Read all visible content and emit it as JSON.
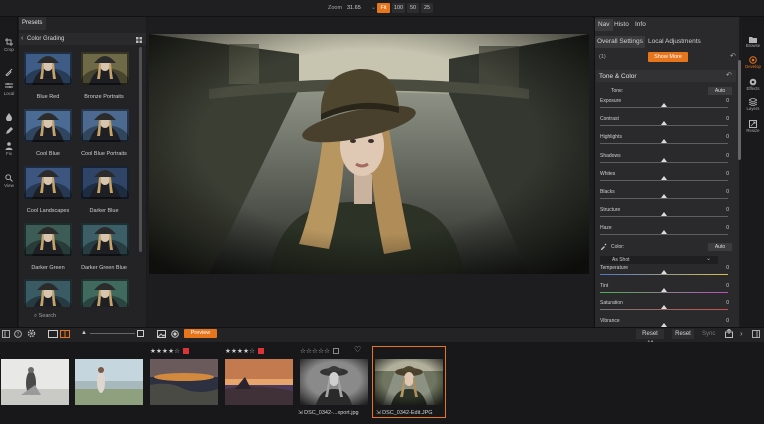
{
  "topbar": {
    "zoom_label": "Zoom",
    "zoom_value": "31.65",
    "zoom_buttons": [
      "Fit",
      "100",
      "50",
      "25"
    ],
    "active_zoom": "Fit"
  },
  "tools": [
    "Crop",
    "",
    "Local",
    "",
    "Fix",
    "View"
  ],
  "presets": {
    "tab": "Presets",
    "category": "Color Grading",
    "items": [
      "Blue Red",
      "Bronze Portraits",
      "Cool Blue",
      "Cool Blue Portraits",
      "Cool Landscapes",
      "Darker Blue",
      "Darker Green",
      "Darker Green Blue"
    ],
    "search": "Search"
  },
  "right_panel": {
    "tabs": [
      "Nav",
      "Histo",
      "Info"
    ],
    "subtabs": [
      "Overall Settings",
      "Local Adjustments"
    ],
    "count": "(1)",
    "show_more": "Show More",
    "section": "Tone & Color",
    "tone_label": "Tone:",
    "auto": "Auto",
    "tone_sliders": [
      {
        "label": "Exposure",
        "value": "0"
      },
      {
        "label": "Contrast",
        "value": "0"
      },
      {
        "label": "Highlights",
        "value": "0"
      },
      {
        "label": "Shadows",
        "value": "0"
      },
      {
        "label": "Whites",
        "value": "0"
      },
      {
        "label": "Blacks",
        "value": "0"
      },
      {
        "label": "Structure",
        "value": "0"
      },
      {
        "label": "Haze",
        "value": "0"
      }
    ],
    "color_label": "Color:",
    "as_shot": "As Shot",
    "color_sliders": [
      {
        "label": "Temperature",
        "value": "0"
      },
      {
        "label": "Tint",
        "value": "0"
      },
      {
        "label": "Saturation",
        "value": "0"
      },
      {
        "label": "Vibrance",
        "value": "0"
      }
    ]
  },
  "modules": [
    "Browse",
    "Develop",
    "Effects",
    "Layers",
    "Resize"
  ],
  "bottombar": {
    "preview": "Preview",
    "reset_all": "Reset All",
    "reset": "Reset",
    "sync": "Sync"
  },
  "filmstrip": {
    "frames": [
      {
        "stars": "",
        "label": ""
      },
      {
        "stars": "",
        "label": ""
      },
      {
        "stars": "★★★★☆",
        "label": ""
      },
      {
        "stars": "★★★★☆",
        "label": ""
      },
      {
        "stars": "☆☆☆☆☆",
        "label": "DSC_0342-...xport.jpg"
      },
      {
        "stars": "",
        "label": "DSC_0342-Edit.JPG"
      }
    ]
  },
  "colors": {
    "accent": "#e7751c",
    "panel": "#2a2a2c",
    "background": "#1b1b1d"
  }
}
